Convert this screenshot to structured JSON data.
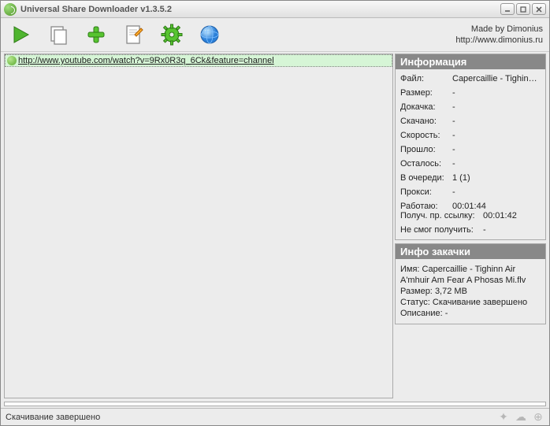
{
  "window": {
    "title": "Universal Share Downloader v1.3.5.2"
  },
  "credits": {
    "line1": "Made by Dimonius",
    "line2": "http://www.dimonius.ru"
  },
  "url_list": [
    {
      "url": "http://www.youtube.com/watch?v=9Rx0R3q_6Ck&feature=channel"
    }
  ],
  "info_panel": {
    "title": "Информация",
    "rows": [
      {
        "key": "Файл:",
        "val": "Capercaillie - Tighinn Air A'r"
      },
      {
        "key": "Размер:",
        "val": "-"
      },
      {
        "key": "Докачка:",
        "val": "-"
      },
      {
        "key": "Скачано:",
        "val": "-"
      },
      {
        "key": "Скорость:",
        "val": "-"
      },
      {
        "key": "Прошло:",
        "val": "-"
      },
      {
        "key": "Осталось:",
        "val": "-"
      },
      {
        "key": "В очереди:",
        "val": "1 (1)"
      },
      {
        "key": "Прокси:",
        "val": "-"
      },
      {
        "key": "Работаю:",
        "val": "00:01:44"
      }
    ],
    "wide_rows": [
      {
        "key": "Получ. пр. ссылку:",
        "val": "00:01:42"
      },
      {
        "key": "Не смог получить:",
        "val": "-"
      }
    ]
  },
  "download_info": {
    "title": "Инфо закачки",
    "name_label": "Имя:",
    "name_value": "Capercaillie - Tighinn Air A'mhuir Am Fear A Phosas Mi.flv",
    "size_label": "Размер:",
    "size_value": "3,72 MB",
    "status_label": "Статус:",
    "status_value": "Скачивание завершено",
    "desc_label": "Описание:",
    "desc_value": "-"
  },
  "statusbar": {
    "text": "Скачивание завершено"
  }
}
